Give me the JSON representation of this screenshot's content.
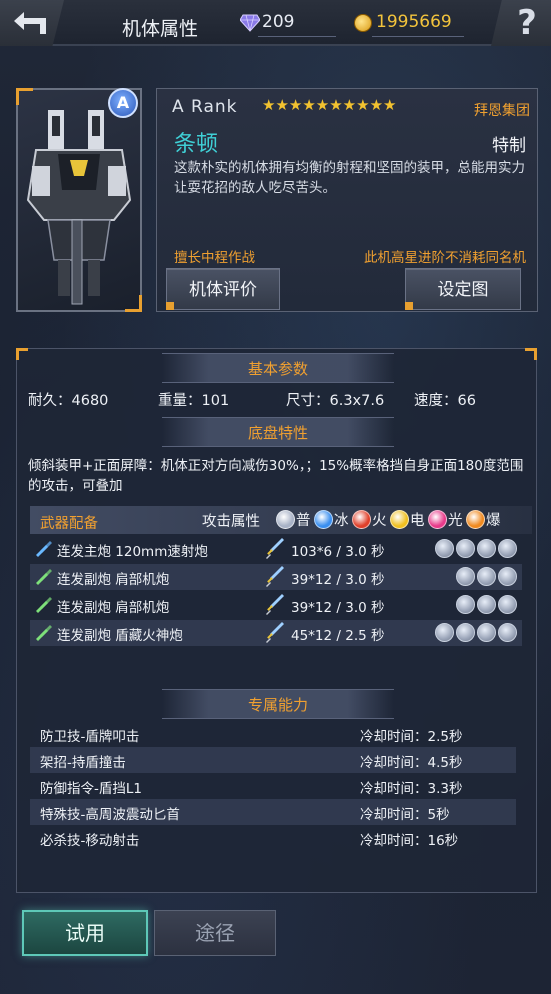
{
  "header": {
    "title": "机体属性",
    "gems": "209",
    "gold": "1995669",
    "help_glyph": "?"
  },
  "mech": {
    "rank_badge": "A",
    "rank_text": "A  Rank",
    "stars": "★★★★★★★★★★",
    "star_count": 10,
    "maker": "拜恩集团",
    "name": "条顿",
    "type": "特制",
    "description": "这款朴实的机体拥有均衡的射程和坚固的装甲，总能用实力让耍花招的敌人吃尽苦头。",
    "tag_left": "擅长中程作战",
    "tag_right": "此机高星进阶不消耗同名机",
    "eval_button": "机体评价",
    "blueprint_button": "设定图"
  },
  "basic": {
    "heading": "基本参数",
    "stats": [
      {
        "label": "耐久：4680"
      },
      {
        "label": "重量：101"
      },
      {
        "label": "尺寸：6.3x7.6"
      },
      {
        "label": "速度：66"
      }
    ]
  },
  "chassis": {
    "heading": "底盘特性",
    "text": "倾斜装甲+正面屏障：机体正对方向减伤30%，；15%概率格挡自身正面180度范围的攻击，可叠加"
  },
  "weapons": {
    "heading": "武器配备",
    "attr_label": "攻击属性",
    "attrs": [
      {
        "name": "普",
        "color": "#a8b2c6"
      },
      {
        "name": "冰",
        "color": "#3a8ff0"
      },
      {
        "name": "火",
        "color": "#e0402a"
      },
      {
        "name": "电",
        "color": "#f0c020"
      },
      {
        "name": "光",
        "color": "#e83a8a"
      },
      {
        "name": "爆",
        "color": "#f08a20"
      }
    ],
    "items": [
      {
        "name": "连发主炮  120mm速射炮",
        "damage": "103*6 / 3.0 秒",
        "slots": 4
      },
      {
        "name": "连发副炮  肩部机炮",
        "damage": "39*12 / 3.0 秒",
        "slots": 3
      },
      {
        "name": "连发副炮  肩部机炮",
        "damage": "39*12 / 3.0 秒",
        "slots": 3
      },
      {
        "name": "连发副炮  盾藏火神炮",
        "damage": "45*12 / 2.5 秒",
        "slots": 4
      }
    ]
  },
  "skills": {
    "heading": "专属能力",
    "items": [
      {
        "name": "防卫技-盾牌叩击",
        "cooldown": "冷却时间：2.5秒"
      },
      {
        "name": "架招-持盾撞击",
        "cooldown": "冷却时间：4.5秒"
      },
      {
        "name": "防御指令-盾挡L1",
        "cooldown": "冷却时间：3.3秒"
      },
      {
        "name": "特殊技-高周波震动匕首",
        "cooldown": "冷却时间：5秒"
      },
      {
        "name": "必杀技-移动射击",
        "cooldown": "冷却时间：16秒"
      }
    ]
  },
  "bottom": {
    "try_button": "试用",
    "route_button": "途径"
  }
}
